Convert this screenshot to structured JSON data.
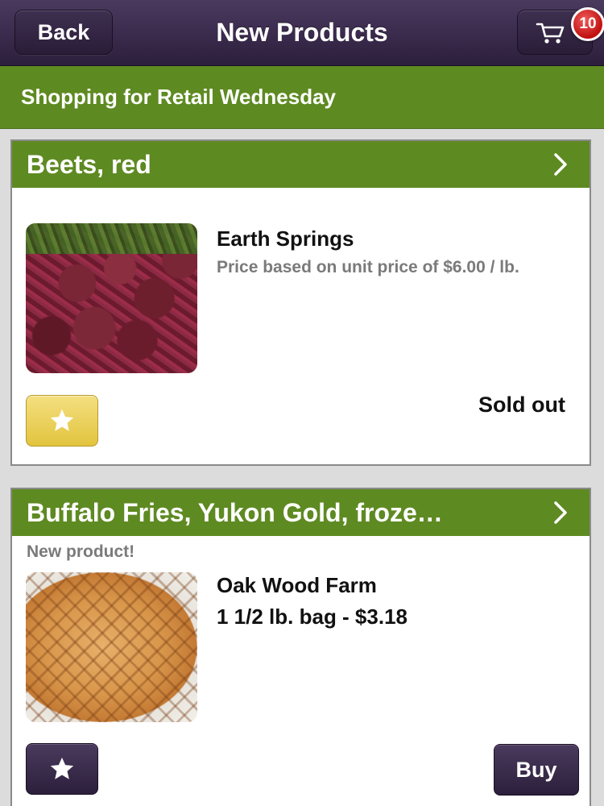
{
  "header": {
    "back_label": "Back",
    "title": "New Products",
    "cart_count": "10",
    "cart_icon": "shopping-cart-icon"
  },
  "shopping_bar": {
    "text": "Shopping for Retail Wednesday"
  },
  "colors": {
    "header_purple": "#3a2a4c",
    "accent_green": "#5e8a22",
    "favorite_gold": "#e2c43e",
    "badge_red": "#c01010"
  },
  "products": [
    {
      "name": "Beets, red",
      "chevron": "›",
      "producer": "Earth Springs",
      "price_note": "Price based on unit price of $6.00 / lb.",
      "status": "Sold out",
      "favorite_icon": "star-icon",
      "favorited": true
    },
    {
      "name": "Buffalo Fries, Yukon Gold, froze…",
      "chevron": "›",
      "tag": "New product!",
      "producer": "Oak Wood Farm",
      "price": "1 1/2 lb. bag - $3.18",
      "buy_label": "Buy",
      "favorite_icon": "star-icon",
      "favorited": false
    }
  ]
}
